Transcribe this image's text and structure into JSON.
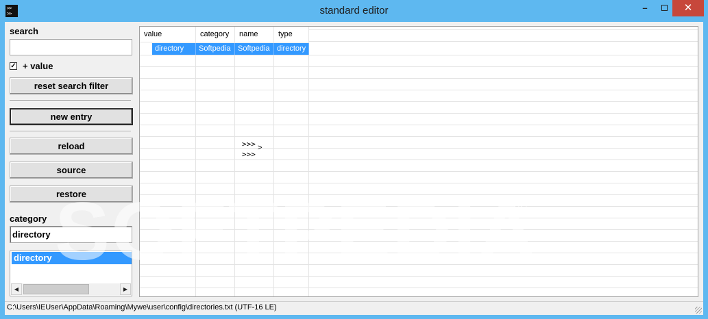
{
  "window": {
    "title": "standard editor",
    "icon_glyph": ">>\n>>",
    "minimize_glyph": "–",
    "close_glyph": "✕"
  },
  "left": {
    "search_label": "search",
    "search_value": "",
    "value_checkbox_checked": "✓",
    "value_checkbox_label": "+ value",
    "reset_button": "reset search filter",
    "new_entry_button": "new entry",
    "reload_button": "reload",
    "source_button": "source",
    "restore_button": "restore",
    "category_label": "category",
    "category_value": "directory",
    "category_list": [
      "directory"
    ],
    "scroll_left": "◀",
    "scroll_right": "▶"
  },
  "table": {
    "headers": [
      "value",
      "category",
      "name",
      "type"
    ],
    "rows": [
      [
        "directory",
        "Softpedia",
        "Softpedia",
        "directory"
      ]
    ],
    "mid_text_line1": ">>>",
    "mid_text_line2": ">>>",
    "mid_arrow": ">"
  },
  "status": {
    "path": "C:\\Users\\IEUser\\AppData\\Roaming\\Mywe\\user\\config\\directories.txt (UTF-16 LE)"
  },
  "watermark": {
    "text": "SOFTPEDIA",
    "mark": "®"
  },
  "colors": {
    "titlebar": "#5eb8f0",
    "selection": "#3399ff",
    "close": "#c7473b"
  }
}
